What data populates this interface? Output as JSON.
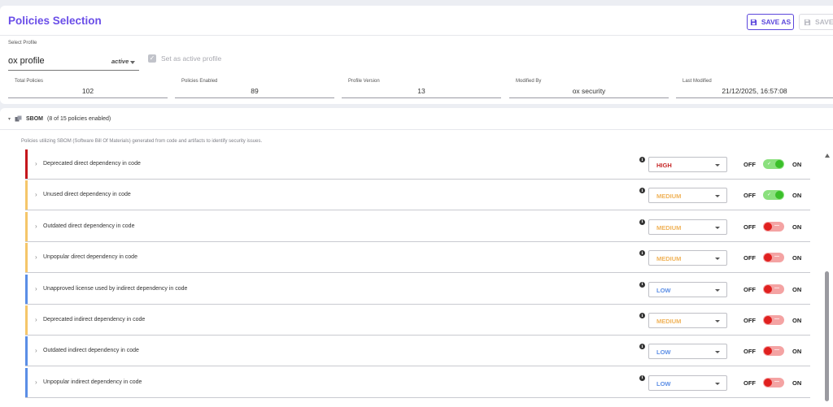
{
  "header": {
    "title": "Policies Selection",
    "save_as_label": "SAVE AS",
    "save_label": "SAVE"
  },
  "profile": {
    "select_label": "Select Profile",
    "name": "ox profile",
    "status": "active",
    "set_active_label": "Set as active profile",
    "set_active_checked": true
  },
  "stats": [
    {
      "label": "Total Policies",
      "value": "102"
    },
    {
      "label": "Policies Enabled",
      "value": "89"
    },
    {
      "label": "Profile Version",
      "value": "13"
    },
    {
      "label": "Modified By",
      "value": "ox security"
    },
    {
      "label": "Last Modified",
      "value": "21/12/2025, 16:57:08"
    }
  ],
  "section": {
    "title": "SBOM",
    "count": "(8 of 15 policies enabled)",
    "description": "Policies utilizing SBOM (Software Bill Of Materials) generated from code and artifacts to identify security issues."
  },
  "toggle_labels": {
    "off": "OFF",
    "on": "ON"
  },
  "colors": {
    "HIGH": "#c62828",
    "MEDIUM": "#f0b35a",
    "LOW": "#5b8ee6",
    "bar_HIGH": "#c4161c",
    "bar_MEDIUM": "#f5c66a",
    "bar_LOW": "#5b8ee6"
  },
  "policies": [
    {
      "name": "Deprecated direct dependency in code",
      "severity": "HIGH",
      "enabled": true
    },
    {
      "name": "Unused direct dependency in code",
      "severity": "MEDIUM",
      "enabled": true
    },
    {
      "name": "Outdated direct dependency in code",
      "severity": "MEDIUM",
      "enabled": false
    },
    {
      "name": "Unpopular direct dependency in code",
      "severity": "MEDIUM",
      "enabled": false
    },
    {
      "name": "Unapproved license used by indirect dependency in code",
      "severity": "LOW",
      "enabled": false
    },
    {
      "name": "Deprecated indirect dependency in code",
      "severity": "MEDIUM",
      "enabled": false
    },
    {
      "name": "Outdated indirect dependency in code",
      "severity": "LOW",
      "enabled": false
    },
    {
      "name": "Unpopular indirect dependency in code",
      "severity": "LOW",
      "enabled": false
    }
  ]
}
